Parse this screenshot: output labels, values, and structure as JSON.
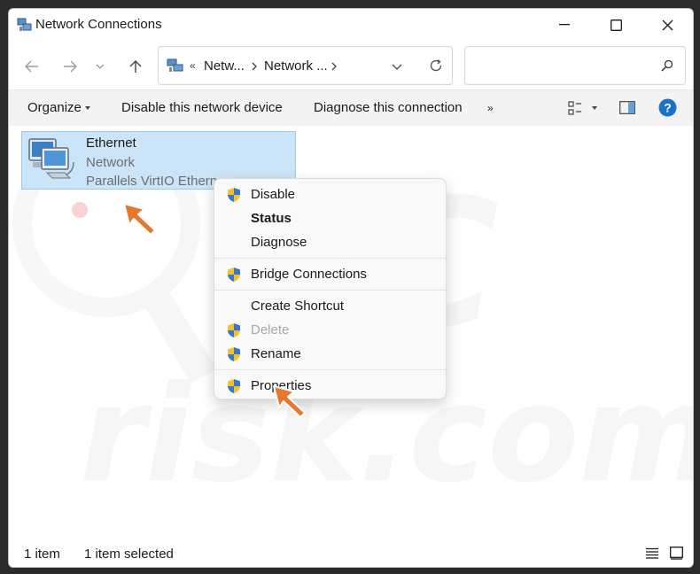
{
  "window": {
    "title": "Network Connections",
    "title_icon": "network-connections-icon",
    "controls": [
      "minimize-icon",
      "maximize-icon",
      "close-icon"
    ]
  },
  "address": {
    "breadcrumbs": [
      "Netw...",
      "Network ..."
    ],
    "overflow_marker": "«",
    "search_placeholder": ""
  },
  "commandbar": {
    "organize": "Organize",
    "disable": "Disable this network device",
    "diagnose": "Diagnose this connection",
    "more": "»"
  },
  "item": {
    "name": "Ethernet",
    "status": "Network",
    "device": "Parallels VirtIO Ethern"
  },
  "context_menu": {
    "items": [
      {
        "label": "Disable",
        "shield": true,
        "bold": false,
        "disabled": false
      },
      {
        "label": "Status",
        "shield": false,
        "bold": true,
        "disabled": false
      },
      {
        "label": "Diagnose",
        "shield": false,
        "bold": false,
        "disabled": false
      },
      {
        "label": "Bridge Connections",
        "shield": true,
        "bold": false,
        "disabled": false
      },
      {
        "label": "Create Shortcut",
        "shield": false,
        "bold": false,
        "disabled": false
      },
      {
        "label": "Delete",
        "shield": true,
        "bold": false,
        "disabled": true
      },
      {
        "label": "Rename",
        "shield": true,
        "bold": false,
        "disabled": false
      },
      {
        "label": "Properties",
        "shield": true,
        "bold": false,
        "disabled": false
      }
    ]
  },
  "statusbar": {
    "count": "1 item",
    "selected": "1 item selected"
  },
  "colors": {
    "selection": "#cce4f7",
    "accent_arrow": "#e8772e",
    "help": "#1a73c9"
  }
}
